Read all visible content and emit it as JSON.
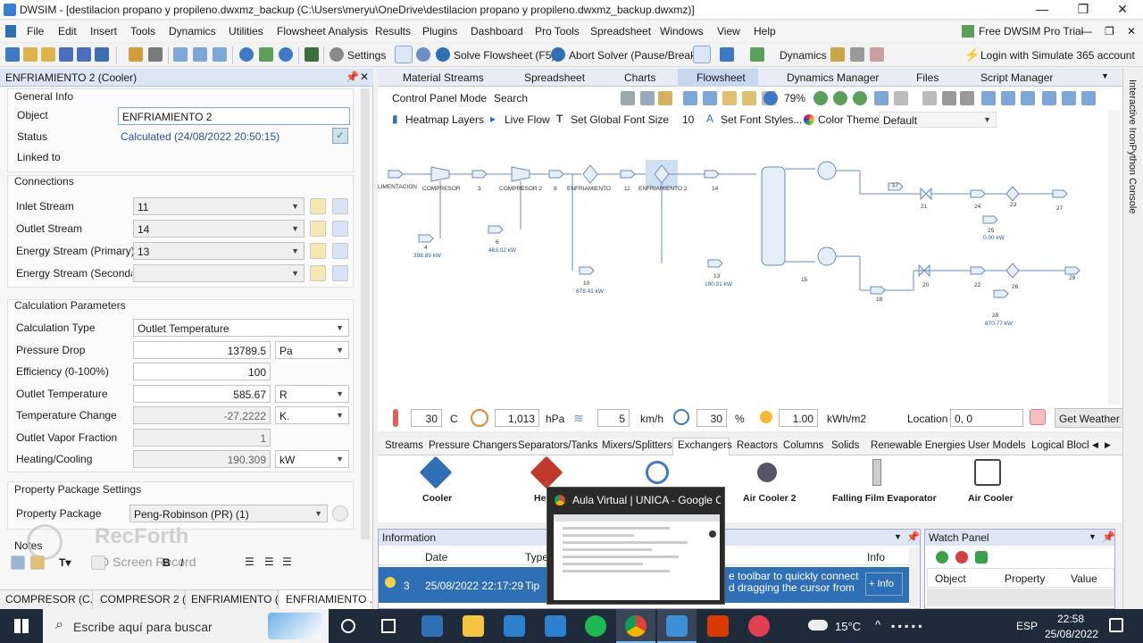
{
  "window": {
    "title": "DWSIM - [destilacion propano y propileno.dwxmz_backup (C:\\Users\\meryu\\OneDrive\\destilacion propano y propileno.dwxmz_backup.dwxmz)]",
    "minimize": "—",
    "restore": "❐",
    "close": "✕"
  },
  "menu": {
    "items": [
      "File",
      "Edit",
      "Insert",
      "Tools",
      "Dynamics",
      "Utilities",
      "Flowsheet Analysis",
      "Results",
      "Plugins",
      "Dashboard",
      "Pro Tools",
      "Spreadsheet",
      "Windows",
      "View",
      "Help"
    ],
    "free_pro": "Free DWSIM Pro Trial",
    "login": "Login with Simulate 365 account"
  },
  "toolbar": {
    "settings": "Settings",
    "solve": "Solve Flowsheet (F5)",
    "abort": "Abort Solver (Pause/Break)",
    "dynamics": "Dynamics"
  },
  "editor": {
    "title": "ENFRIAMIENTO 2 (Cooler)",
    "general_info": "General Info",
    "object_label": "Object",
    "object_value": "ENFRIAMIENTO 2",
    "status_label": "Status",
    "status_value": "Calculated (24/08/2022 20:50:15)",
    "linked_label": "Linked to",
    "connections": "Connections",
    "inlet_label": "Inlet Stream",
    "inlet_value": "11",
    "outlet_label": "Outlet Stream",
    "outlet_value": "14",
    "energy_label": "Energy Stream (Primary)",
    "energy_value": "13",
    "energy2_label": "Energy Stream (Secondary)",
    "calc_params": "Calculation Parameters",
    "calc_type_label": "Calculation Type",
    "calc_type_value": "Outlet Temperature",
    "pdrop_label": "Pressure Drop",
    "pdrop_value": "13789.5",
    "pdrop_unit": "Pa",
    "eff_label": "Efficiency (0-100%)",
    "eff_value": "100",
    "outT_label": "Outlet Temperature",
    "outT_value": "585.67",
    "outT_unit": "R",
    "dT_label": "Temperature Change",
    "dT_value": "-27.2222",
    "dT_unit": "K.",
    "ovf_label": "Outlet Vapor Fraction",
    "ovf_value": "1",
    "heat_label": "Heating/Cooling",
    "heat_value": "190.309",
    "heat_unit": "kW",
    "pp_settings": "Property Package Settings",
    "pp_label": "Property Package",
    "pp_value": "Peng-Robinson (PR) (1)",
    "notes": "Notes",
    "watermark": "RecForth",
    "watermark2": "HD Screen Record"
  },
  "doc_tabs": [
    "COMPRESOR (C...",
    "COMPRESOR 2 (...",
    "ENFRIAMIENTO (...",
    "ENFRIAMIENTO ..."
  ],
  "main_tabs": [
    "Material Streams",
    "Spreadsheet",
    "Charts",
    "Flowsheet",
    "Dynamics Manager",
    "Files",
    "Script Manager"
  ],
  "flowsheet_toolbar": {
    "control_panel": "Control Panel Mode",
    "search": "Search",
    "zoom": "79%",
    "heatmap": "Heatmap Layers",
    "live_flow": "Live Flow",
    "global_font": "Set Global Font Size",
    "font_size": "10",
    "font_styles": "Set Font Styles...",
    "color_theme": "Color Theme",
    "theme_value": "Default"
  },
  "flowsheet": {
    "labels": [
      "LIMENTACION",
      "COMPRESOR",
      "3",
      "COMPRESOR 2",
      "8",
      "ENFRIAMIENTO",
      "11",
      "ENFRIAMIENTO 2",
      "14",
      "17",
      "21",
      "24",
      "23",
      "27",
      "25",
      "0.00 kW",
      "4",
      "398.89 kW",
      "6",
      "463.02 kW",
      "10",
      "678.41 kW",
      "13",
      "190.31 kW",
      "15",
      "18",
      "20",
      "22",
      "26",
      "29",
      "28",
      "870.77 kW"
    ]
  },
  "weather": {
    "temp": "30",
    "temp_unit": "C",
    "pressure": "1,013",
    "pressure_unit": "hPa",
    "wind": "5",
    "wind_unit": "km/h",
    "humidity": "30",
    "humidity_unit": "%",
    "solar": "1.00",
    "solar_unit": "kWh/m2",
    "location_label": "Location",
    "location_value": "0, 0",
    "get_weather": "Get Weather"
  },
  "object_tabs": [
    "Streams",
    "Pressure Changers",
    "Separators/Tanks",
    "Mixers/Splitters",
    "Exchangers",
    "Reactors",
    "Columns",
    "Solids",
    "Renewable Energies",
    "User Models",
    "Logical Block"
  ],
  "objects": [
    "Cooler",
    "He",
    "Air Cooler 2",
    "Falling Film Evaporator",
    "Air Cooler"
  ],
  "info": {
    "title": "Information",
    "col_date": "Date",
    "col_type": "Type",
    "col_info": "Info",
    "row_num": "3",
    "row_date": "25/08/2022 22:17:29",
    "row_type": "Tip",
    "row_msg1": "e toolbar to quickly connect",
    "row_msg2": "d dragging the cursor from",
    "more": "+ Info"
  },
  "watch": {
    "title": "Watch Panel",
    "col_object": "Object",
    "col_property": "Property",
    "col_value": "Value"
  },
  "chrome_popup": {
    "title": "Aula Virtual | UNICA - Google C..."
  },
  "side_strip": "Interactive IronPython Console",
  "taskbar": {
    "search": "Escribe aquí para buscar",
    "weather": "15°C",
    "lang": "ESP",
    "time": "22:58",
    "date": "25/08/2022"
  },
  "colors": {
    "accent": "#2f6fb5",
    "panel_header": "#dce6f4",
    "taskbar": "#1f2a3a"
  }
}
